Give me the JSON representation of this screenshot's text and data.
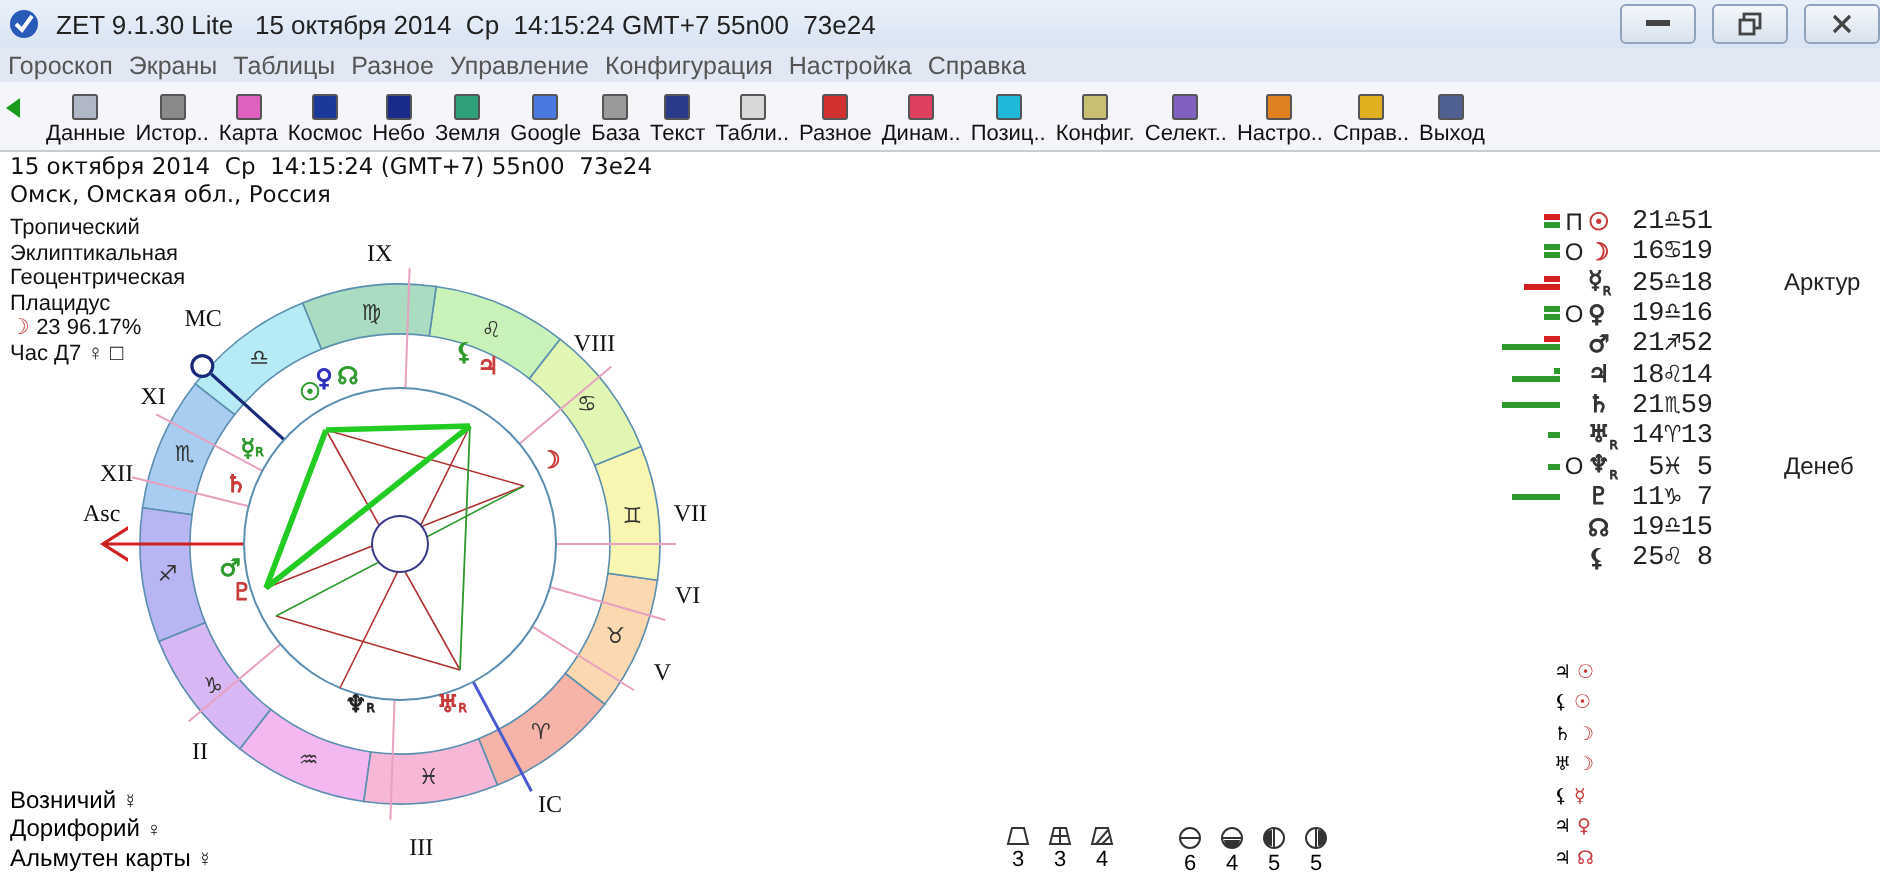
{
  "window": {
    "title": "ZET 9.1.30 Lite   15 октября 2014  Ср  14:15:24 GMT+7 55n00  73e24"
  },
  "menu": [
    "Гороскоп",
    "Экраны",
    "Таблицы",
    "Разное",
    "Управление",
    "Конфигурация",
    "Настройка",
    "Справка"
  ],
  "toolbar": [
    {
      "label": "Данные",
      "color": "#b0b8c8"
    },
    {
      "label": "Истор..",
      "color": "#8a8a8a"
    },
    {
      "label": "Карта",
      "color": "#e060c0"
    },
    {
      "label": "Космос",
      "color": "#1a3a9a"
    },
    {
      "label": "Небо",
      "color": "#1a2a8a"
    },
    {
      "label": "Земля",
      "color": "#2ea07a"
    },
    {
      "label": "Google",
      "color": "#4a7ae0"
    },
    {
      "label": "База",
      "color": "#9a9a9a"
    },
    {
      "label": "Текст",
      "color": "#2a3a8a"
    },
    {
      "label": "Табли..",
      "color": "#d8d8d8"
    },
    {
      "label": "Разное",
      "color": "#d03030"
    },
    {
      "label": "Динам..",
      "color": "#e04060"
    },
    {
      "label": "Позиц..",
      "color": "#20b8d8"
    },
    {
      "label": "Конфиг.",
      "color": "#c8c070"
    },
    {
      "label": "Селект..",
      "color": "#8060c0"
    },
    {
      "label": "Настро..",
      "color": "#e08020"
    },
    {
      "label": "Справ..",
      "color": "#e0b020"
    },
    {
      "label": "Выход",
      "color": "#506090"
    }
  ],
  "header": {
    "date": "15 октября 2014  Ср  14:15:24 (GMT+7) 55n00  73e24",
    "place": "Омск, Омская обл., Россия"
  },
  "settings": [
    "Тропический",
    "Эклиптикальная",
    "Геоцентрическая",
    "Плацидус"
  ],
  "moon_phase": {
    "glyph": "☽",
    "value": "23 96.17%"
  },
  "hour": {
    "label": "Час Д7",
    "planet": "♀",
    "aspect": "□"
  },
  "signs": [
    {
      "glyph": "♈",
      "color": "#f6b3a8"
    },
    {
      "glyph": "♉",
      "color": "#fbd8b0"
    },
    {
      "glyph": "♊",
      "color": "#f8f6b0"
    },
    {
      "glyph": "♋",
      "color": "#e2f6b4"
    },
    {
      "glyph": "♌",
      "color": "#c8f2b8"
    },
    {
      "glyph": "♍",
      "color": "#a9dcc0"
    },
    {
      "glyph": "♎",
      "color": "#b6eaf4"
    },
    {
      "glyph": "♏",
      "color": "#a8cdf0"
    },
    {
      "glyph": "♐",
      "color": "#b8b6f2"
    },
    {
      "glyph": "♑",
      "color": "#d8b8f4"
    },
    {
      "glyph": "♒",
      "color": "#f4b8f0"
    },
    {
      "glyph": "♓",
      "color": "#f7b8d8"
    }
  ],
  "houses": [
    {
      "label": "Asc"
    },
    {
      "label": "II"
    },
    {
      "label": "III"
    },
    {
      "label": "IC"
    },
    {
      "label": "V"
    },
    {
      "label": "VI"
    },
    {
      "label": "VII"
    },
    {
      "label": "VIII"
    },
    {
      "label": "IX"
    },
    {
      "label": "MC"
    },
    {
      "label": "XI"
    },
    {
      "label": "XII"
    }
  ],
  "wheel_planets": [
    {
      "glyph": "☉",
      "color": "#2e9a2e"
    },
    {
      "glyph": "♀",
      "color": "#3030c0"
    },
    {
      "glyph": "☊",
      "color": "#2e9a2e"
    },
    {
      "glyph": "☿",
      "retro": "R",
      "color": "#2e9a2e"
    },
    {
      "glyph": "♄",
      "color": "#c83a3a"
    },
    {
      "glyph": "⚸",
      "color": "#2e9a2e"
    },
    {
      "glyph": "♃",
      "color": "#c83a3a"
    },
    {
      "glyph": "☽",
      "color": "#c83a3a"
    },
    {
      "glyph": "♂",
      "color": "#2e9a2e"
    },
    {
      "glyph": "♇",
      "color": "#c83a3a"
    },
    {
      "glyph": "♆",
      "retro": "R",
      "color": "#222222"
    },
    {
      "glyph": "♅",
      "retro": "R",
      "color": "#c83a3a"
    }
  ],
  "rulers": [
    {
      "label": "Возничий",
      "glyph": "☿"
    },
    {
      "label": "Дорифорий",
      "glyph": "♀"
    },
    {
      "label": "Альмутен карты",
      "glyph": "☿"
    }
  ],
  "modalities": [
    {
      "kind": "trapezoid",
      "count": "3"
    },
    {
      "kind": "grid",
      "count": "3"
    },
    {
      "kind": "hatched",
      "count": "4"
    }
  ],
  "elements": [
    {
      "kind": "bar",
      "count": "6"
    },
    {
      "kind": "bowl",
      "count": "4"
    },
    {
      "kind": "split",
      "count": "5"
    },
    {
      "kind": "split-right",
      "count": "5"
    }
  ],
  "positions": [
    {
      "marker": "П",
      "glyph": "☉",
      "color": "#c83a3a",
      "position": "21♎51",
      "bars": [
        {
          "color": "#d42020",
          "kind": "short"
        },
        {
          "color": "#2e9a2e",
          "kind": "short"
        }
      ]
    },
    {
      "marker": "О",
      "glyph": "☽",
      "color": "#c83a3a",
      "position": "16♋19",
      "bars": [
        {
          "color": "#2e9a2e",
          "kind": "short"
        },
        {
          "color": "#2e9a2e",
          "kind": "short"
        }
      ]
    },
    {
      "glyph": "☿",
      "retro": "R",
      "color": "#333333",
      "position": "25♎18",
      "star": "Арктур",
      "bars": [
        {
          "color": "#d42020",
          "kind": "short"
        },
        {
          "color": "#d42020",
          "kind": "medium"
        }
      ]
    },
    {
      "marker": "О",
      "glyph": "♀",
      "color": "#333333",
      "position": "19♎16",
      "bars": [
        {
          "color": "#2e9a2e",
          "kind": "short"
        },
        {
          "color": "#2e9a2e",
          "kind": "short"
        }
      ]
    },
    {
      "glyph": "♂",
      "color": "#333333",
      "position": "21♐52",
      "bars": [
        {
          "color": "#d42020",
          "kind": "short"
        },
        {
          "color": "#2e9a2e",
          "kind": "long"
        }
      ]
    },
    {
      "glyph": "♃",
      "color": "#333333",
      "position": "18♌14",
      "bars": [
        {
          "color": "#2e9a2e",
          "kind": "tiny"
        },
        {
          "color": "#2e9a2e",
          "kind": "wide"
        }
      ]
    },
    {
      "glyph": "♄",
      "color": "#333333",
      "position": "21♏59",
      "bars": [
        {
          "color": "#2e9a2e",
          "kind": "long"
        }
      ]
    },
    {
      "glyph": "♅",
      "retro": "R",
      "color": "#333333",
      "position": "14♈13",
      "bars": [
        {
          "color": "#2e9a2e",
          "kind": "small"
        }
      ]
    },
    {
      "marker": "О",
      "glyph": "♆",
      "retro": "R",
      "color": "#333333",
      "position": " 5♓ 5",
      "star": "Денеб",
      "bars": [
        {
          "color": "#2e9a2e",
          "kind": "small"
        }
      ]
    },
    {
      "glyph": "♇",
      "color": "#333333",
      "position": "11♑ 7",
      "bars": [
        {
          "color": "#2e9a2e",
          "kind": "wide"
        }
      ]
    },
    {
      "glyph": "☊",
      "color": "#333333",
      "position": "19♎15"
    },
    {
      "glyph": "⚸",
      "color": "#333333",
      "position": "25♌ 8"
    }
  ],
  "receptions": [
    {
      "text": "♃ ",
      "glyph": "☉"
    },
    {
      "text": "⚸ ",
      "glyph": "☉"
    },
    {
      "text": "♄ ",
      "glyph": "☽"
    },
    {
      "text": "♅ ",
      "glyph": "☽"
    },
    {
      "text": "⚸ ",
      "glyph": "☿"
    },
    {
      "text": "♃ ",
      "glyph": "♀"
    },
    {
      "text": "♃ ",
      "glyph": "☊"
    }
  ]
}
